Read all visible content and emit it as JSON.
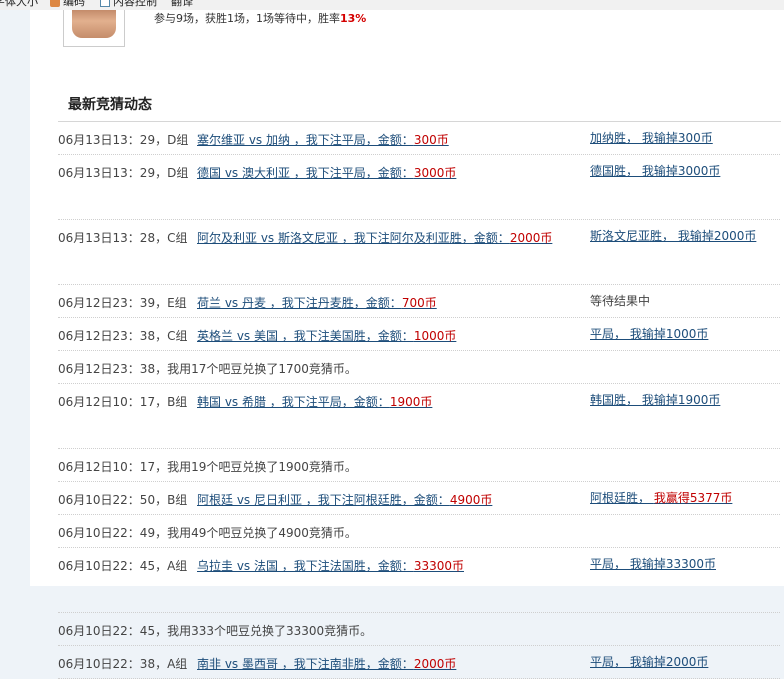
{
  "toolbar": {
    "font_size": "字体大小",
    "encoding": "编码",
    "content_control": "内容控制",
    "translate": "翻译"
  },
  "profile": {
    "stats_prefix": "参与9场，获胜1场，1场等待中，胜率",
    "win_rate": "13%"
  },
  "section_title": "最新竞猜动态",
  "rows": [
    {
      "kind": "bet",
      "time": "06月13日13：29，D组",
      "bet_text": "塞尔维亚 vs 加纳 ，我下注平局，金额：",
      "amount": "300币",
      "result": "加纳胜， 我输掉300币",
      "result_extra": ""
    },
    {
      "kind": "bet",
      "time": "06月13日13：29，D组",
      "bet_text": "德国 vs 澳大利亚 ，我下注平局，金额：",
      "amount": "3000币",
      "result": "德国胜， 我输掉3000币",
      "result_extra": ""
    },
    {
      "kind": "bet",
      "time": "06月13日13：28，C组",
      "bet_text": "阿尔及利亚 vs 斯洛文尼亚 ，我下注阿尔及利亚胜，金额：",
      "amount": "2000币",
      "result": "斯洛文尼亚胜， 我输掉2000币",
      "result_extra": ""
    },
    {
      "kind": "bet",
      "time": "06月12日23：39，E组",
      "bet_text": "荷兰 vs 丹麦 ，我下注丹麦胜，金额：",
      "amount": "700币",
      "result": "等待结果中",
      "result_extra": ""
    },
    {
      "kind": "bet",
      "time": "06月12日23：38，C组",
      "bet_text": "英格兰 vs 美国 ，我下注美国胜，金额：",
      "amount": "1000币",
      "result": "平局， 我输掉1000币",
      "result_extra": ""
    },
    {
      "kind": "plain",
      "text": "06月12日23：38，我用17个吧豆兑换了1700竞猜币。"
    },
    {
      "kind": "bet",
      "time": "06月12日10：17，B组",
      "bet_text": "韩国 vs 希腊 ，我下注平局，金额：",
      "amount": "1900币",
      "result": "韩国胜， 我输掉1900币",
      "result_extra": ""
    },
    {
      "kind": "plain",
      "text": "06月12日10：17，我用19个吧豆兑换了1900竞猜币。"
    },
    {
      "kind": "bet",
      "time": "06月10日22：50，B组",
      "bet_text": "阿根廷 vs 尼日利亚 ，我下注阿根廷胜，金额：",
      "amount": "4900币",
      "result": "阿根廷胜， ",
      "result_extra": "我赢得5377币"
    },
    {
      "kind": "plain",
      "text": "06月10日22：49，我用49个吧豆兑换了4900竞猜币。"
    },
    {
      "kind": "bet",
      "time": "06月10日22：45，A组",
      "bet_text": "乌拉圭 vs 法国 ，我下注法国胜，金额：",
      "amount": "33300币",
      "result": "平局， 我输掉33300币",
      "result_extra": ""
    },
    {
      "kind": "plain",
      "text": "06月10日22：45，我用333个吧豆兑换了33300竞猜币。"
    },
    {
      "kind": "bet",
      "time": "06月10日22：38，A组",
      "bet_text": "南非 vs 墨西哥 ，我下注南非胜，金额：",
      "amount": "2000币",
      "result": "平局， 我输掉2000币",
      "result_extra": ""
    }
  ]
}
